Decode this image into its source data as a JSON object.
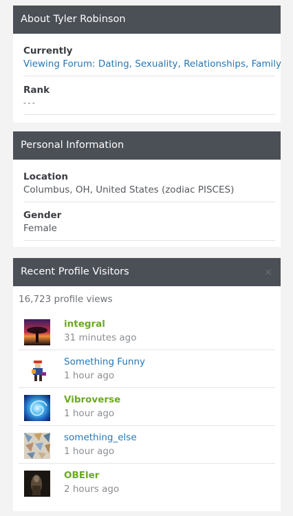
{
  "about": {
    "header": "About Tyler Robinson",
    "fields": [
      {
        "label": "Currently",
        "value": "Viewing Forum: Dating, Sexuality, Relationships, Family"
      },
      {
        "label": "Rank",
        "value": "- - -"
      }
    ]
  },
  "personal": {
    "header": "Personal Information",
    "fields": [
      {
        "label": "Location",
        "value": "Columbus, OH, United States (zodiac PISCES)"
      },
      {
        "label": "Gender",
        "value": "Female"
      }
    ]
  },
  "visitors": {
    "header": "Recent Profile Visitors",
    "close_glyph": "×",
    "views": "16,723 profile views",
    "items": [
      {
        "name": "integral",
        "time": "31 minutes ago",
        "style": "green"
      },
      {
        "name": "Something Funny",
        "time": "1 hour ago",
        "style": "blue"
      },
      {
        "name": "Vibroverse",
        "time": "1 hour ago",
        "style": "green"
      },
      {
        "name": "something_else",
        "time": "1 hour ago",
        "style": "blue"
      },
      {
        "name": "OBEler",
        "time": "2 hours ago",
        "style": "green"
      }
    ]
  },
  "colors": {
    "header_bg": "#4b4f56",
    "link_blue": "#2277b8",
    "member_green": "#6aaa1f",
    "page_bg": "#f3f3f4"
  }
}
